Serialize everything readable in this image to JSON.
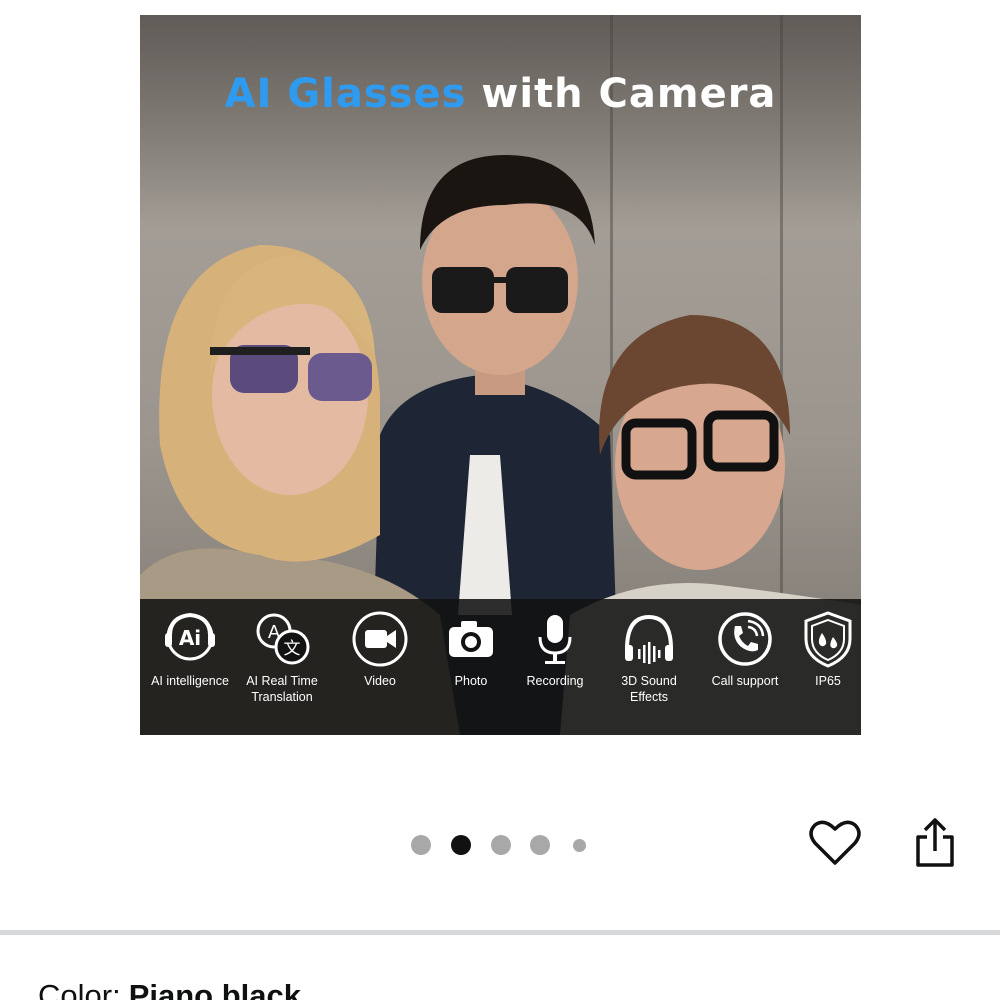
{
  "product_image": {
    "headline_highlight": "AI Glasses",
    "headline_rest": "with Camera",
    "features": [
      {
        "icon": "ai-chip-icon",
        "label": "AI intelligence"
      },
      {
        "icon": "translation-icon",
        "label": "AI Real Time\nTranslation"
      },
      {
        "icon": "video-camera-icon",
        "label": "Video"
      },
      {
        "icon": "photo-camera-icon",
        "label": "Photo"
      },
      {
        "icon": "microphone-icon",
        "label": "Recording"
      },
      {
        "icon": "headphones-icon",
        "label": "3D Sound Effects"
      },
      {
        "icon": "phone-call-icon",
        "label": "Call support"
      },
      {
        "icon": "waterproof-shield-icon",
        "label": "IP65"
      }
    ],
    "colors": {
      "highlight": "#2f9bf0",
      "text": "#ffffff",
      "feature_bar": "#121212"
    }
  },
  "carousel": {
    "page_count": 5,
    "active_index": 1
  },
  "actions": {
    "favorite_icon": "heart-icon",
    "share_icon": "share-icon"
  },
  "variation": {
    "label": "Color:",
    "value": "Piano black"
  }
}
